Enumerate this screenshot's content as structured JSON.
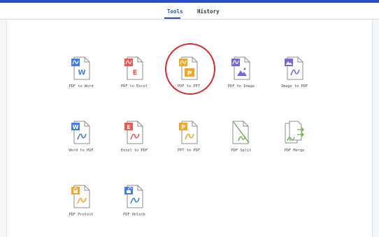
{
  "tabs": [
    {
      "label": "Tools",
      "active": true
    },
    {
      "label": "History",
      "active": false
    }
  ],
  "colors": {
    "accent": "#2b4cc9",
    "word": "#3f7ee8",
    "pdf": "#f0564e",
    "ppt": "#f5a623",
    "image": "#7b63e6",
    "highlight": "#e0242a"
  },
  "tools": [
    {
      "label": "PDF to Word",
      "icon": "pdf-to-word-icon",
      "badge": "W"
    },
    {
      "label": "PDF to Excel",
      "icon": "pdf-to-excel-icon",
      "badge": "E"
    },
    {
      "label": "PDF to PPT",
      "icon": "pdf-to-ppt-icon",
      "badge": "P"
    },
    {
      "label": "PDF to Image",
      "icon": "pdf-to-image-icon",
      "badge": ""
    },
    {
      "label": "Image to PDF",
      "icon": "image-to-pdf-icon",
      "badge": ""
    },
    {
      "label": "Word to PDF",
      "icon": "word-to-pdf-icon",
      "badge": "W"
    },
    {
      "label": "Excel to PDF",
      "icon": "excel-to-pdf-icon",
      "badge": "E"
    },
    {
      "label": "PPT to PDF",
      "icon": "ppt-to-pdf-icon",
      "badge": "P"
    },
    {
      "label": "PDF Split",
      "icon": "pdf-split-icon",
      "badge": ""
    },
    {
      "label": "PDF Merge",
      "icon": "pdf-merge-icon",
      "badge": ""
    },
    {
      "label": "PDF Protect",
      "icon": "pdf-protect-icon",
      "badge": ""
    },
    {
      "label": "PDF Unlock",
      "icon": "pdf-unlock-icon",
      "badge": ""
    }
  ]
}
